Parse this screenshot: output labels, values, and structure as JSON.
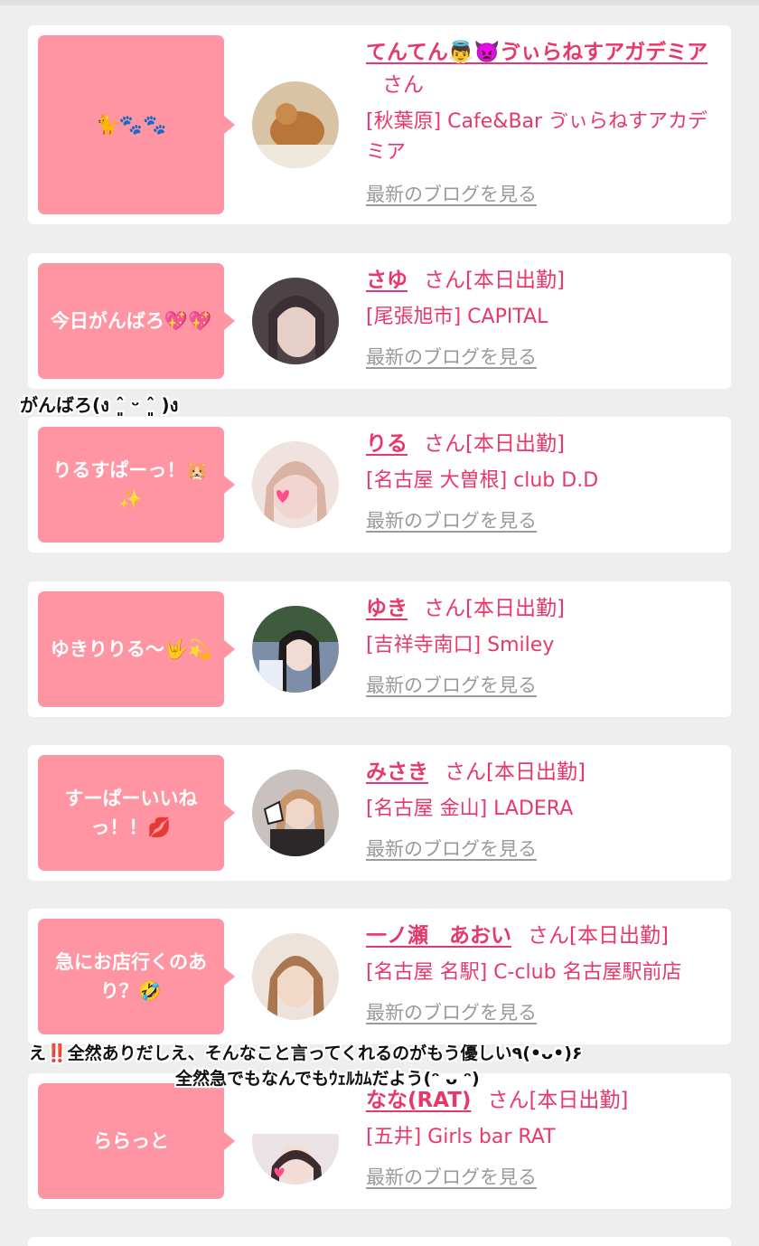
{
  "cards": [
    {
      "bubble": "🐈🐾🐾",
      "name": "てんてん👼👿ゔぃらねすアガデミア",
      "suffix": "さん",
      "shop": "[秋葉原] Cafe&Bar ゔぃらねすアカデミア",
      "blog": "最新のブログを見る",
      "avatar_bg": "#c9a27a"
    },
    {
      "bubble": "今日がんばろ💖💖",
      "name": "さゆ",
      "suffix": "さん[本日出勤]",
      "shop": "[尾張旭市] CAPITAL",
      "blog": "最新のブログを見る",
      "avatar_bg": "#7a6a6f"
    },
    {
      "bubble": "りるすぱーっ！🐹✨",
      "name": "りる",
      "suffix": "さん[本日出勤]",
      "shop": "[名古屋 大曽根] club D.D",
      "blog": "最新のブログを見る",
      "avatar_bg": "#e6c7c2"
    },
    {
      "bubble": "ゆきりりる〜🤟💫",
      "name": "ゆき",
      "suffix": "さん[本日出勤]",
      "shop": "[吉祥寺南口] Smiley",
      "blog": "最新のブログを見る",
      "avatar_bg": "#5b6a86"
    },
    {
      "bubble": "すーぱーいいねっ！！💋",
      "name": "みさき",
      "suffix": "さん[本日出勤]",
      "shop": "[名古屋 金山] LADERA",
      "blog": "最新のブログを見る",
      "avatar_bg": "#9c8c88"
    },
    {
      "bubble": "急にお店行くのあり？🤣",
      "name": "一ノ瀬　あおい",
      "suffix": "さん[本日出勤]",
      "shop": "[名古屋 名駅] C-club 名古屋駅前店",
      "blog": "最新のブログを見る",
      "avatar_bg": "#c8a387"
    },
    {
      "bubble": "ららっと",
      "name": "なな(RAT)",
      "suffix": "さん[本日出勤]",
      "shop": "[五井] Girls bar RAT",
      "blog": "最新のブログを見る",
      "avatar_bg": "#e9dde0"
    }
  ],
  "overlays": {
    "note1": "がんばろ(ง ˆ͈ ᵕ ˆ͈ )ง",
    "note2_line1": "え‼️全然ありだしえ、そんなこと言ってくれるのがもう優しい٩(•ᴗ•)۶",
    "note2_line2": "全然急でもなんでもｳｪﾙｶﾑだよう(ᵔ ᴗ ᵔ)"
  },
  "colors": {
    "accent": "#e8386b",
    "bubble": "#ff95a3",
    "link_gray": "#9a9a9a",
    "background": "#eeeeee"
  }
}
